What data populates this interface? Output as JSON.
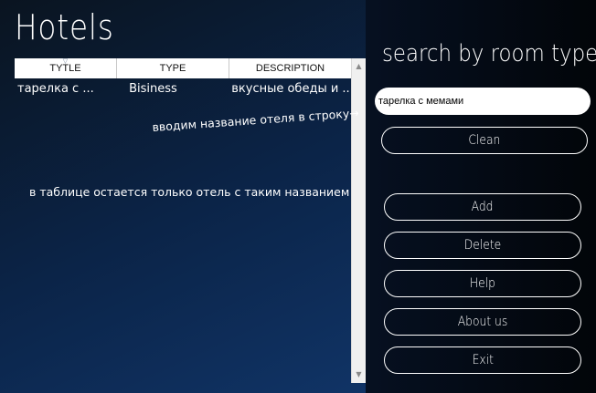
{
  "app": {
    "title": "Hotels"
  },
  "table": {
    "columns": [
      "TYTLE",
      "TYPE",
      "DESCRIPTION"
    ],
    "rows": [
      [
        "тарелка с ...",
        "Bisiness",
        "вкусные обеды и ..."
      ]
    ]
  },
  "annotations": {
    "enter_name": "вводим название отеля в строку→",
    "result": "в таблице остается только отель с таким названием"
  },
  "search": {
    "title": "search by room type",
    "value": "тарелка с мемами",
    "placeholder": ""
  },
  "buttons": {
    "clean": "Clean",
    "add": "Add",
    "delete": "Delete",
    "help": "Help",
    "about": "About us",
    "exit": "Exit"
  },
  "icons": {
    "sort": "sort-indicator-icon",
    "scroll_up": "scroll-up-arrow-icon",
    "scroll_down": "scroll-down-arrow-icon"
  },
  "colors": {
    "background_dark": "#0a1420",
    "background_blue": "#123a72",
    "panel": "#020509",
    "button_border": "#ffffff"
  }
}
